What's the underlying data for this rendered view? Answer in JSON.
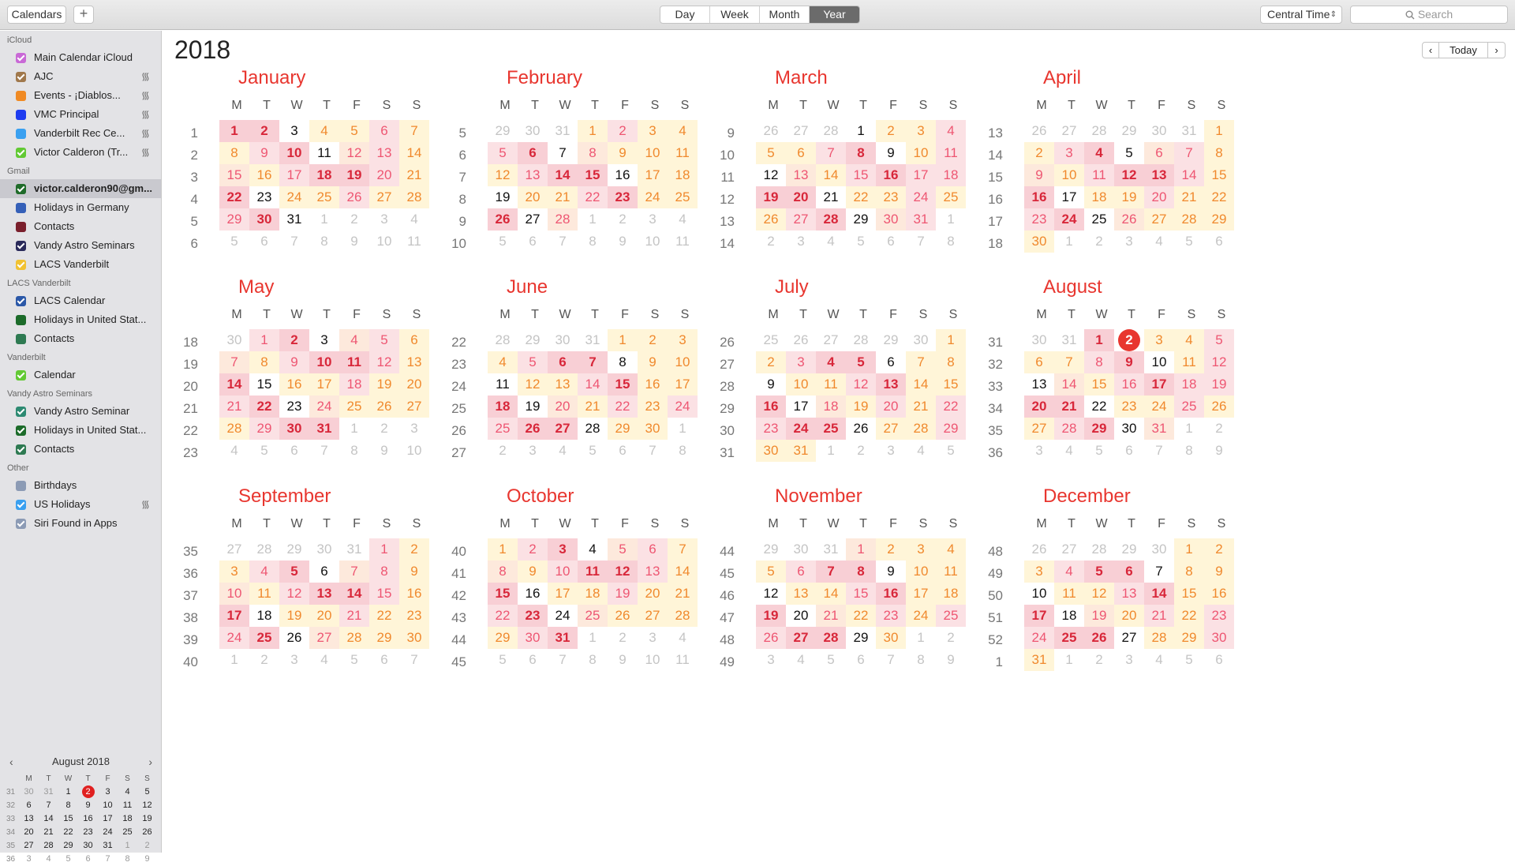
{
  "toolbar": {
    "calendars_label": "Calendars",
    "add_label": "+",
    "views": [
      "Day",
      "Week",
      "Month",
      "Year"
    ],
    "active_view": "Year",
    "timezone": "Central Time",
    "search_placeholder": "Search"
  },
  "sidebar": {
    "groups": [
      {
        "title": "iCloud",
        "items": [
          {
            "label": "Main Calendar iCloud",
            "color": "#c969d6",
            "checked": true,
            "shared": false
          },
          {
            "label": "AJC",
            "color": "#a0784c",
            "checked": true,
            "shared": true
          },
          {
            "label": "Events - ¡Diablos...",
            "color": "#f08a24",
            "checked": false,
            "shared": true
          },
          {
            "label": "VMC Principal",
            "color": "#1e3cf0",
            "checked": false,
            "shared": true
          },
          {
            "label": "Vanderbilt Rec Ce...",
            "color": "#3aa0f0",
            "checked": false,
            "shared": true
          },
          {
            "label": "Victor Calderon (Tr...",
            "color": "#62c934",
            "checked": true,
            "shared": true
          }
        ]
      },
      {
        "title": "Gmail",
        "items": [
          {
            "label": "victor.calderon90@gm...",
            "color": "#1f6b2a",
            "checked": true,
            "shared": false,
            "selected": true
          },
          {
            "label": "Holidays in Germany",
            "color": "#3560b8",
            "checked": false,
            "shared": false
          },
          {
            "label": "Contacts",
            "color": "#7a1f2c",
            "checked": false,
            "shared": false
          },
          {
            "label": "Vandy Astro Seminars",
            "color": "#2a2a5a",
            "checked": true,
            "shared": false
          },
          {
            "label": "LACS Vanderbilt",
            "color": "#f1c232",
            "checked": true,
            "shared": false
          }
        ]
      },
      {
        "title": "LACS Vanderbilt",
        "items": [
          {
            "label": "LACS Calendar",
            "color": "#2b58a8",
            "checked": true,
            "shared": false
          },
          {
            "label": "Holidays in United Stat...",
            "color": "#1c6b2a",
            "checked": false,
            "shared": false
          },
          {
            "label": "Contacts",
            "color": "#2e7a52",
            "checked": false,
            "shared": false
          }
        ]
      },
      {
        "title": "Vanderbilt",
        "items": [
          {
            "label": "Calendar",
            "color": "#62c934",
            "checked": true,
            "shared": false
          }
        ]
      },
      {
        "title": "Vandy Astro Seminars",
        "items": [
          {
            "label": "Vandy Astro Seminar",
            "color": "#2d8a72",
            "checked": true,
            "shared": false
          },
          {
            "label": "Holidays in United Stat...",
            "color": "#1c6b2a",
            "checked": true,
            "shared": false
          },
          {
            "label": "Contacts",
            "color": "#2e7a52",
            "checked": true,
            "shared": false
          }
        ]
      },
      {
        "title": "Other",
        "items": [
          {
            "label": "Birthdays",
            "color": "#8c9bb5",
            "checked": false,
            "shared": false
          },
          {
            "label": "US Holidays",
            "color": "#3aa0f0",
            "checked": true,
            "shared": true
          },
          {
            "label": "Siri Found in Apps",
            "color": "#8c9bb5",
            "checked": true,
            "shared": false
          }
        ]
      }
    ],
    "mini_calendar": {
      "title": "August 2018",
      "weekday_headers": [
        "M",
        "T",
        "W",
        "T",
        "F",
        "S",
        "S"
      ],
      "rows": [
        {
          "week": "31",
          "days": [
            "30",
            "31",
            "1",
            "2",
            "3",
            "4",
            "5"
          ]
        },
        {
          "week": "32",
          "days": [
            "6",
            "7",
            "8",
            "9",
            "10",
            "11",
            "12"
          ]
        },
        {
          "week": "33",
          "days": [
            "13",
            "14",
            "15",
            "16",
            "17",
            "18",
            "19"
          ]
        },
        {
          "week": "34",
          "days": [
            "20",
            "21",
            "22",
            "23",
            "24",
            "25",
            "26"
          ]
        },
        {
          "week": "35",
          "days": [
            "27",
            "28",
            "29",
            "30",
            "31",
            "1",
            "2"
          ]
        },
        {
          "week": "36",
          "days": [
            "3",
            "4",
            "5",
            "6",
            "7",
            "8",
            "9"
          ]
        }
      ],
      "today": "2"
    }
  },
  "main": {
    "year": "2018",
    "prev_label": "‹",
    "today_label": "Today",
    "next_label": "›",
    "weekday_headers": [
      "M",
      "T",
      "W",
      "T",
      "F",
      "S",
      "S"
    ],
    "months": [
      {
        "name": "January",
        "weeks": [
          "1",
          "2",
          "3",
          "4",
          "5",
          "6"
        ],
        "start": 0,
        "len": 31,
        "prevLen": 31
      },
      {
        "name": "February",
        "weeks": [
          "5",
          "6",
          "7",
          "8",
          "9",
          "10"
        ],
        "start": 3,
        "len": 28,
        "prevLen": 31
      },
      {
        "name": "March",
        "weeks": [
          "9",
          "10",
          "11",
          "12",
          "13",
          "14"
        ],
        "start": 3,
        "len": 31,
        "prevLen": 28
      },
      {
        "name": "April",
        "weeks": [
          "13",
          "14",
          "15",
          "16",
          "17",
          "18"
        ],
        "start": 6,
        "len": 30,
        "prevLen": 31
      },
      {
        "name": "May",
        "weeks": [
          "18",
          "19",
          "20",
          "21",
          "22",
          "23"
        ],
        "start": 1,
        "len": 31,
        "prevLen": 30
      },
      {
        "name": "June",
        "weeks": [
          "22",
          "23",
          "24",
          "25",
          "26",
          "27"
        ],
        "start": 4,
        "len": 30,
        "prevLen": 31
      },
      {
        "name": "July",
        "weeks": [
          "26",
          "27",
          "28",
          "29",
          "30",
          "31"
        ],
        "start": 6,
        "len": 31,
        "prevLen": 30
      },
      {
        "name": "August",
        "weeks": [
          "31",
          "32",
          "33",
          "34",
          "35",
          "36"
        ],
        "start": 2,
        "len": 31,
        "prevLen": 31
      },
      {
        "name": "September",
        "weeks": [
          "35",
          "36",
          "37",
          "38",
          "39",
          "40"
        ],
        "start": 5,
        "len": 30,
        "prevLen": 31
      },
      {
        "name": "October",
        "weeks": [
          "40",
          "41",
          "42",
          "43",
          "44",
          "45"
        ],
        "start": 0,
        "len": 31,
        "prevLen": 30
      },
      {
        "name": "November",
        "weeks": [
          "44",
          "45",
          "46",
          "47",
          "48",
          "49"
        ],
        "start": 3,
        "len": 30,
        "prevLen": 31
      },
      {
        "name": "December",
        "weeks": [
          "48",
          "49",
          "50",
          "51",
          "52",
          "1"
        ],
        "start": 5,
        "len": 31,
        "prevLen": 30
      }
    ],
    "today": {
      "month": 7,
      "day": 2
    }
  }
}
